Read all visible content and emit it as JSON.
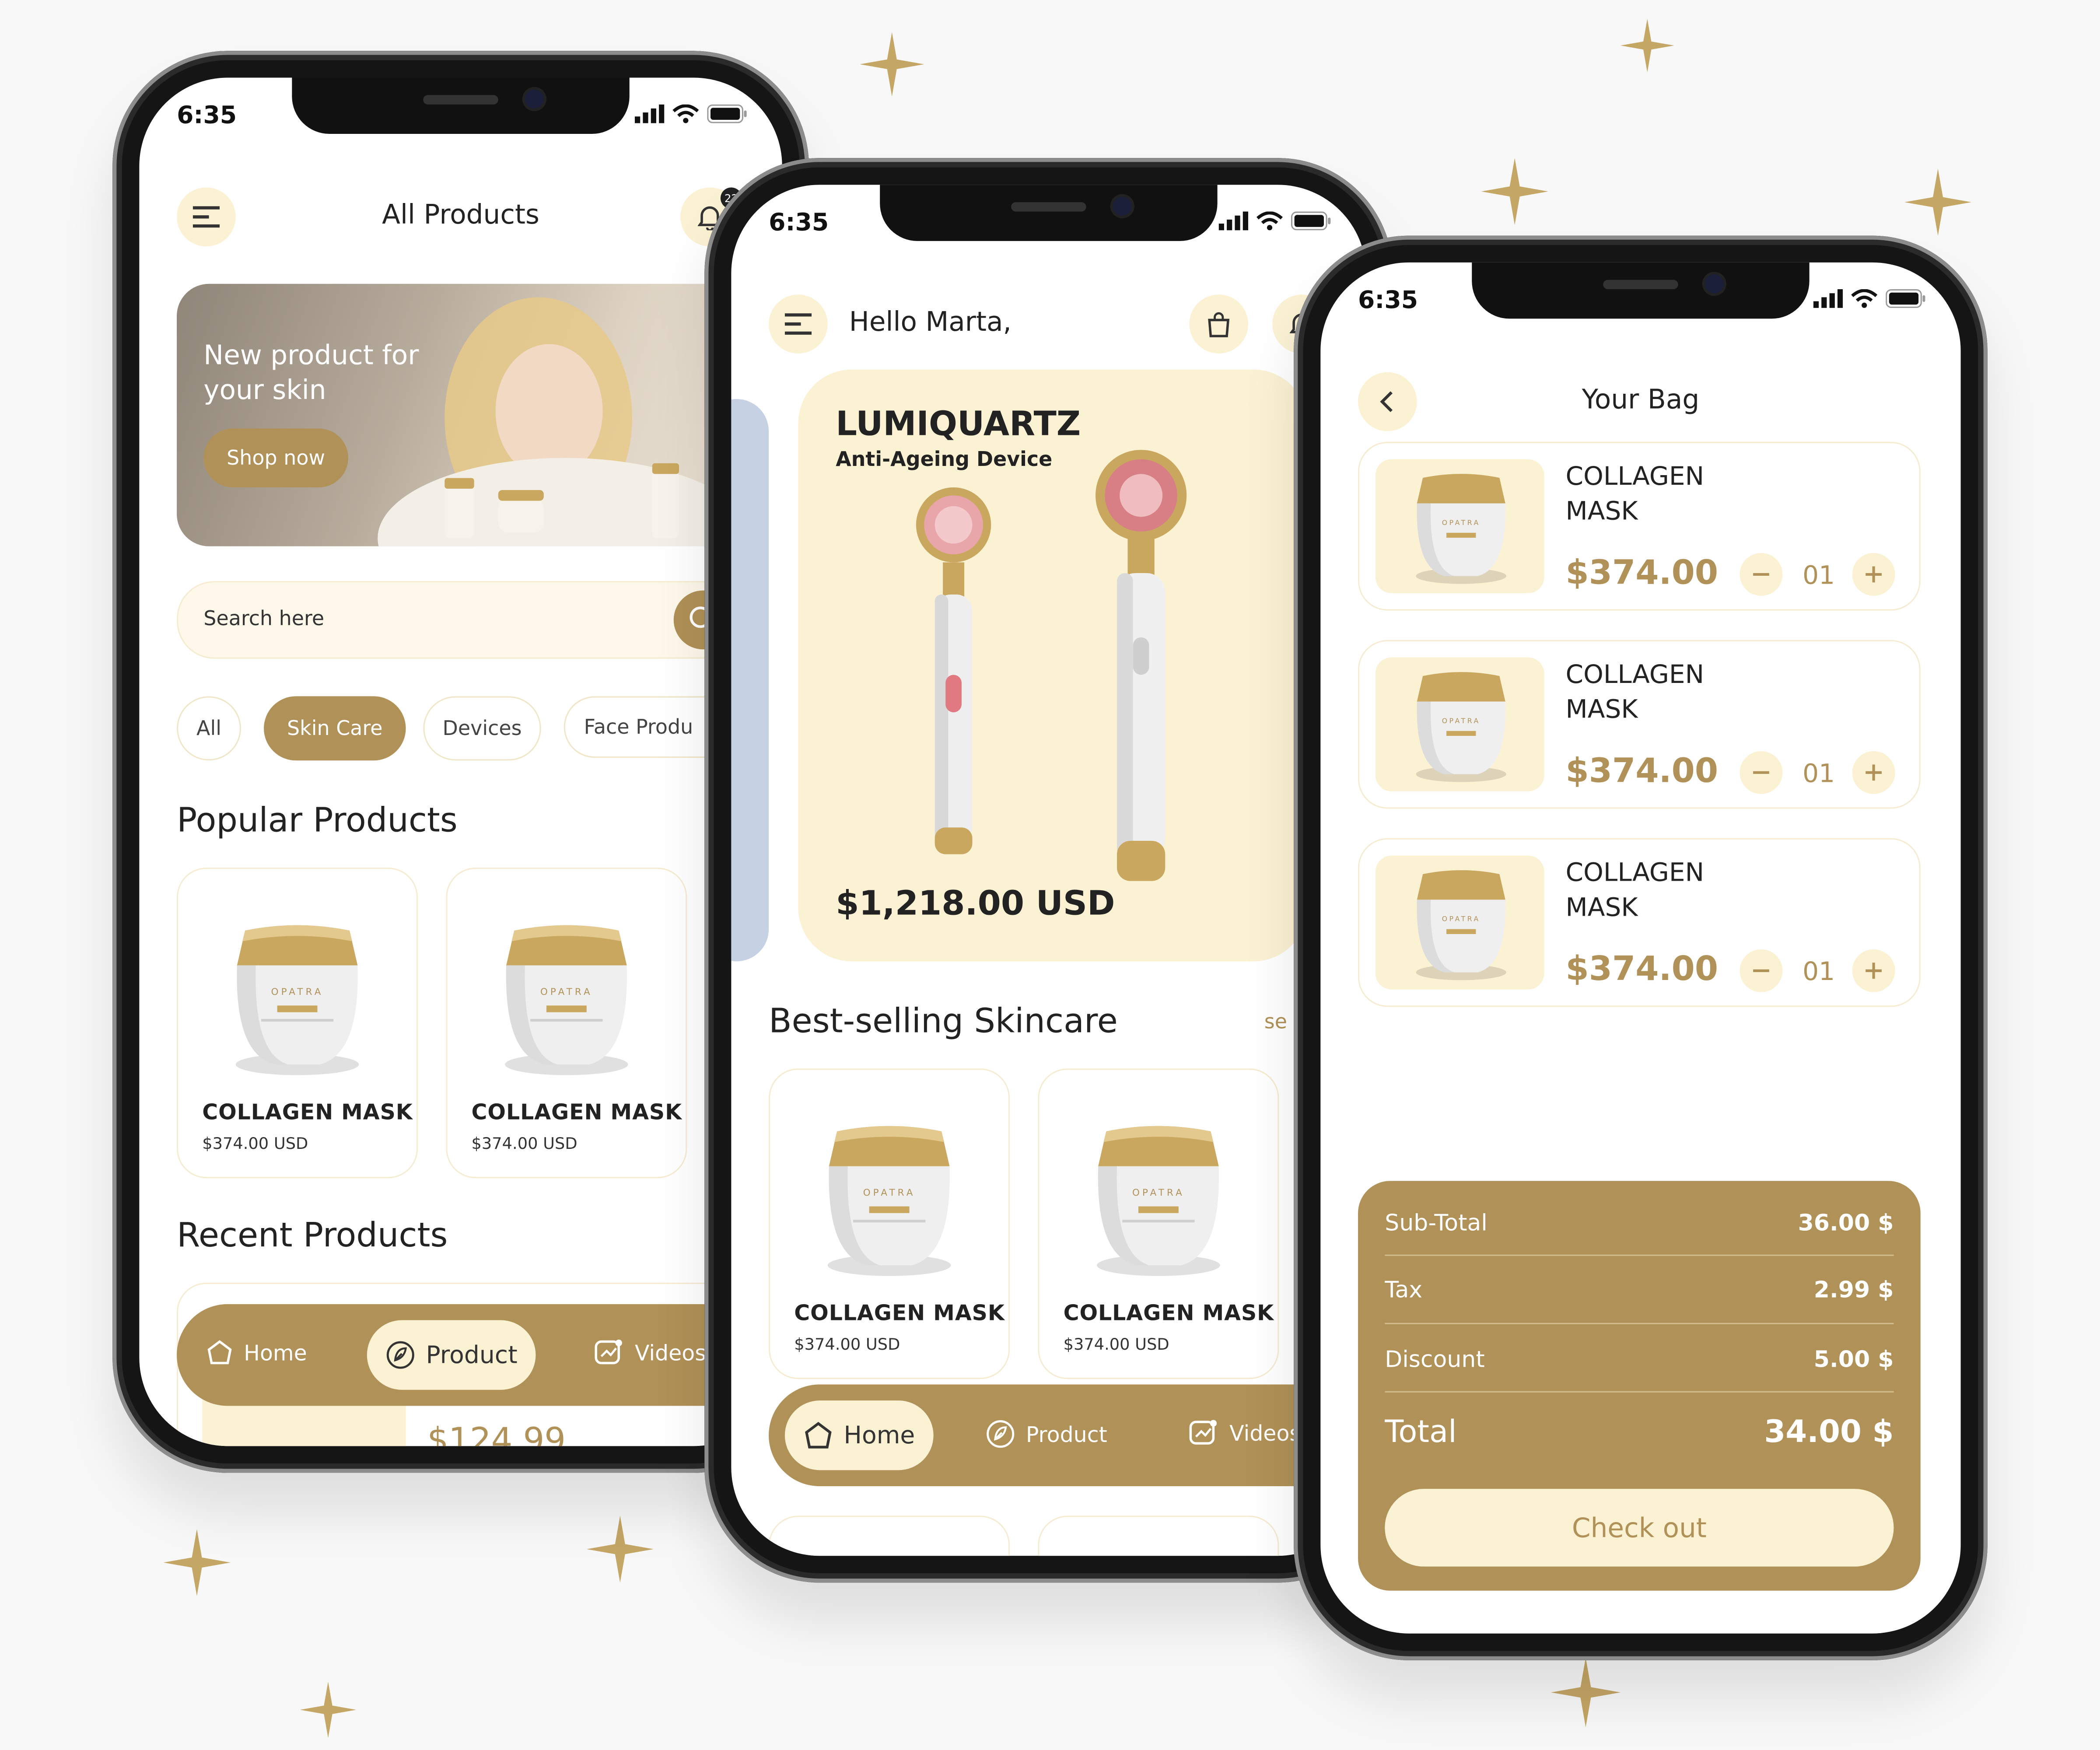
{
  "status_time": "6:35",
  "colors": {
    "accent": "#b09157",
    "cream": "#fbf1d3",
    "text": "#222222"
  },
  "screen1": {
    "title": "All Products",
    "badge": "22",
    "banner": {
      "heading_line1": "New product for",
      "heading_line2": "your skin",
      "cta": "Shop now"
    },
    "search": {
      "placeholder": "Search here"
    },
    "chips": [
      {
        "label": "All"
      },
      {
        "label": "Skin Care"
      },
      {
        "label": "Devices"
      },
      {
        "label": "Face Produ"
      }
    ],
    "popular_title": "Popular Products",
    "products": [
      {
        "name": "COLLAGEN MASK",
        "price": "$374.00 USD"
      },
      {
        "name": "COLLAGEN MASK",
        "price": "$374.00 USD"
      }
    ],
    "recent_title": "Recent Products",
    "recent_price": "$124.99",
    "nav": {
      "home": "Home",
      "product": "Product",
      "videos": "Videos"
    }
  },
  "screen2": {
    "greeting": "Hello Marta,",
    "hero": {
      "title": "LUMIQUARTZ",
      "subtitle": "Anti-Ageing Device",
      "price": "$1,218.00 USD"
    },
    "bestselling_title": "Best-selling Skincare",
    "see_all": "se",
    "products": [
      {
        "name": "COLLAGEN MASK",
        "price": "$374.00 USD"
      },
      {
        "name": "COLLAGEN MASK",
        "price": "$374.00 USD"
      }
    ],
    "nav": {
      "home": "Home",
      "product": "Product",
      "videos": "Videos"
    }
  },
  "screen3": {
    "title": "Your Bag",
    "items": [
      {
        "name_line1": "COLLAGEN",
        "name_line2": "MASK",
        "price": "$374.00",
        "qty": "01"
      },
      {
        "name_line1": "COLLAGEN",
        "name_line2": "MASK",
        "price": "$374.00",
        "qty": "01"
      },
      {
        "name_line1": "COLLAGEN",
        "name_line2": "MASK",
        "price": "$374.00",
        "qty": "01"
      }
    ],
    "summary": {
      "subtotal_label": "Sub-Total",
      "subtotal_value": "36.00 $",
      "tax_label": "Tax",
      "tax_value": "2.99 $",
      "discount_label": "Discount",
      "discount_value": "5.00 $",
      "total_label": "Total",
      "total_value": "34.00 $"
    },
    "checkout": "Check out"
  },
  "icons": {
    "menu": "menu-icon",
    "bell": "bell-icon",
    "bag": "bag-icon",
    "back": "chevron-left-icon",
    "search": "search-icon",
    "home": "home-icon",
    "product": "leaf-icon",
    "videos": "video-icon",
    "minus": "minus-icon",
    "plus": "plus-icon",
    "sparkle": "sparkle-icon"
  }
}
